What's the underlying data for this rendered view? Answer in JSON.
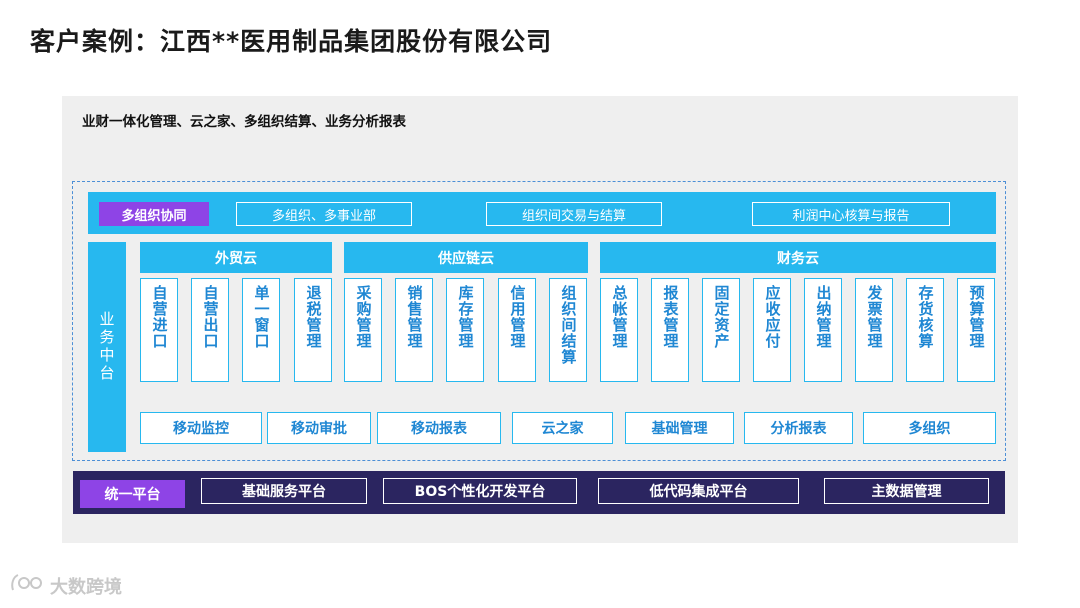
{
  "title": "客户案例：江西**医用制品集团股份有限公司",
  "subtitle": "业财一体化管理、云之家、多组织结算、业务分析报表",
  "collab": {
    "tag": "多组织协同",
    "items": [
      "多组织、多事业部",
      "组织间交易与结算",
      "利润中心核算与报告"
    ]
  },
  "side_label": "业务中台",
  "categories": [
    "外贸云",
    "供应链云",
    "财务云"
  ],
  "modules": {
    "waimao": [
      "自营进口",
      "自营出口",
      "单一窗口",
      "退税管理"
    ],
    "gongying": [
      "采购管理",
      "销售管理",
      "库存管理",
      "信用管理",
      "组织间结算"
    ],
    "caiwu": [
      "总帐管理",
      "报表管理",
      "固定资产",
      "应收应付",
      "出纳管理",
      "发票管理",
      "存货核算",
      "预算管理"
    ]
  },
  "mobile": [
    "移动监控",
    "移动审批",
    "移动报表",
    "云之家",
    "基础管理",
    "分析报表",
    "多组织"
  ],
  "platform": {
    "tag": "统一平台",
    "items": [
      "基础服务平台",
      "BOS个性化开发平台",
      "低代码集成平台",
      "主数据管理"
    ]
  },
  "watermark": "大数跨境"
}
